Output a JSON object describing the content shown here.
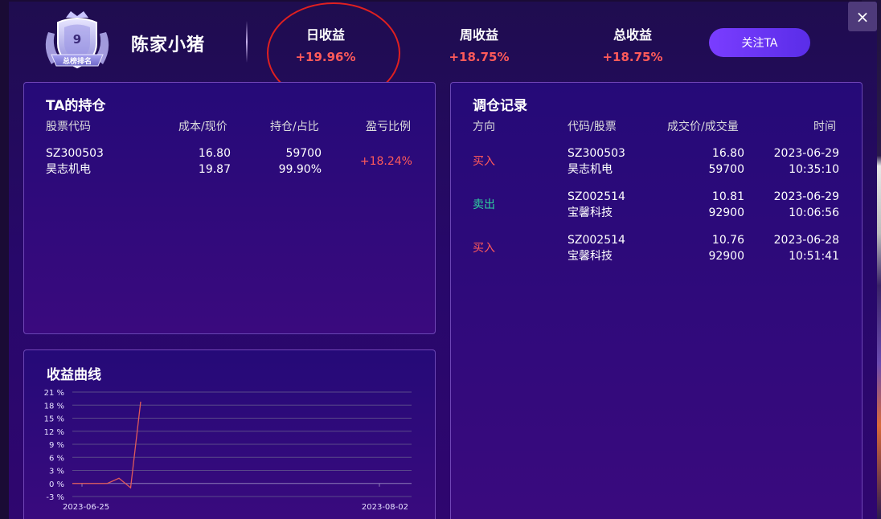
{
  "header": {
    "rank_number": "9",
    "rank_label": "总榜排名",
    "username": "陈家小猪",
    "stats": [
      {
        "label": "日收益",
        "value": "+19.96%"
      },
      {
        "label": "周收益",
        "value": "+18.75%"
      },
      {
        "label": "总收益",
        "value": "+18.75%"
      }
    ],
    "follow_label": "关注TA",
    "close_label": "×"
  },
  "holdings": {
    "title": "TA的持仓",
    "columns": [
      "股票代码",
      "成本/现价",
      "持仓/占比",
      "盈亏比例"
    ],
    "rows": [
      {
        "code": "SZ300503",
        "name": "昊志机电",
        "cost": "16.80",
        "price": "19.87",
        "qty": "59700",
        "ratio": "99.90%",
        "pnl": "+18.24%"
      }
    ]
  },
  "trades": {
    "title": "调仓记录",
    "columns": [
      "方向",
      "代码/股票",
      "成交价/成交量",
      "时间"
    ],
    "rows": [
      {
        "direction": "买入",
        "type": "buy",
        "code": "SZ300503",
        "name": "昊志机电",
        "price": "16.80",
        "volume": "59700",
        "date": "2023-06-29",
        "time": "10:35:10"
      },
      {
        "direction": "卖出",
        "type": "sell",
        "code": "SZ002514",
        "name": "宝馨科技",
        "price": "10.81",
        "volume": "92900",
        "date": "2023-06-29",
        "time": "10:06:56"
      },
      {
        "direction": "买入",
        "type": "buy",
        "code": "SZ002514",
        "name": "宝馨科技",
        "price": "10.76",
        "volume": "92900",
        "date": "2023-06-28",
        "time": "10:51:41"
      }
    ]
  },
  "curve": {
    "title": "收益曲线"
  },
  "colors": {
    "accent": "#6a34f5",
    "positive": "#ff5a5a",
    "negative": "#2fd4a0",
    "line": "#e05a5a"
  },
  "chart_data": {
    "type": "line",
    "title": "收益曲线",
    "xlabel": "",
    "ylabel": "",
    "x_tick_labels": [
      "2023-06-25",
      "2023-08-02"
    ],
    "y_tick_labels": [
      "21 %",
      "18 %",
      "15 %",
      "12 %",
      "9 %",
      "6 %",
      "3 %",
      "0 %",
      "-3 %"
    ],
    "ylim": [
      -3,
      21
    ],
    "grid": true,
    "x": [
      "2023-06-25",
      "2023-06-26",
      "2023-06-27",
      "2023-06-28",
      "2023-06-29",
      "2023-06-30",
      "2023-08-02"
    ],
    "series": [
      {
        "values": [
          0,
          0,
          0,
          0,
          1.2,
          -1.0,
          18.8
        ]
      }
    ]
  }
}
